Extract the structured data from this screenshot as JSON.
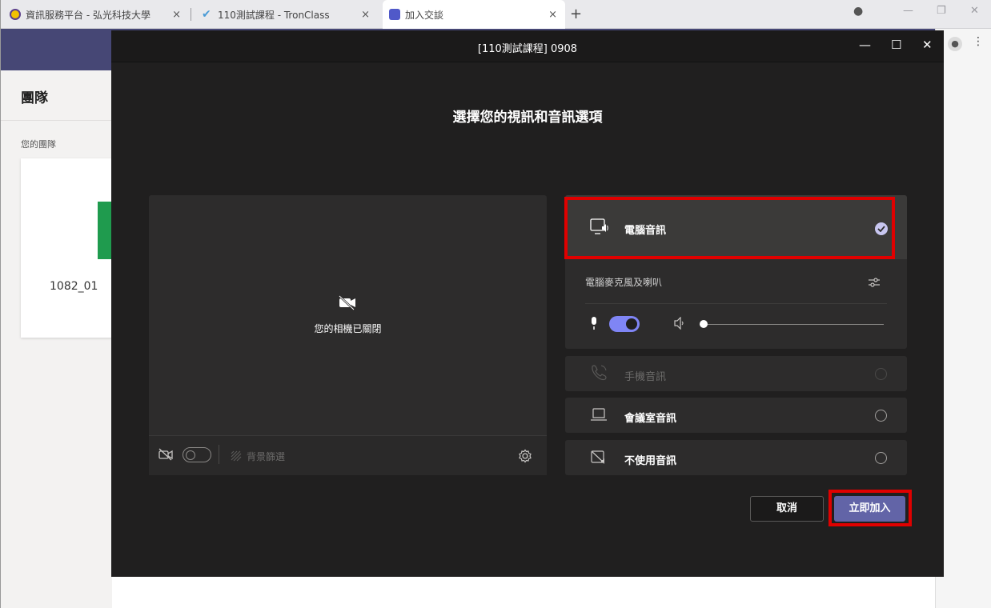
{
  "browser": {
    "tabs": [
      {
        "title": "資訊服務平台 - 弘光科技大學",
        "close": "×"
      },
      {
        "title": "110測試課程 - TronClass",
        "close": "×"
      },
      {
        "title": "加入交談",
        "close": "×"
      }
    ],
    "new_tab": "+"
  },
  "teams_page": {
    "sidebar_title": "團隊",
    "your_teams": "您的團隊",
    "team_name": "1082_01"
  },
  "modal": {
    "title": "[110測試課程] 0908",
    "heading": "選擇您的視訊和音訊選項",
    "camera_off_text": "您的相機已關閉",
    "background_filter": "背景篩選",
    "audio_options": {
      "computer_audio": "電腦音訊",
      "device_label": "電腦麥克風及喇叭",
      "phone_audio": "手機音訊",
      "room_audio": "會議室音訊",
      "no_audio": "不使用音訊"
    },
    "cancel_label": "取消",
    "join_label": "立即加入",
    "mic_enabled": true,
    "camera_enabled": false,
    "selected_audio": "computer_audio"
  },
  "colors": {
    "accent": "#6264a7",
    "toggle_on": "#7f85f5",
    "highlight_box": "#e00000",
    "header": "#464775",
    "team_tile": "#1f9b4e"
  }
}
